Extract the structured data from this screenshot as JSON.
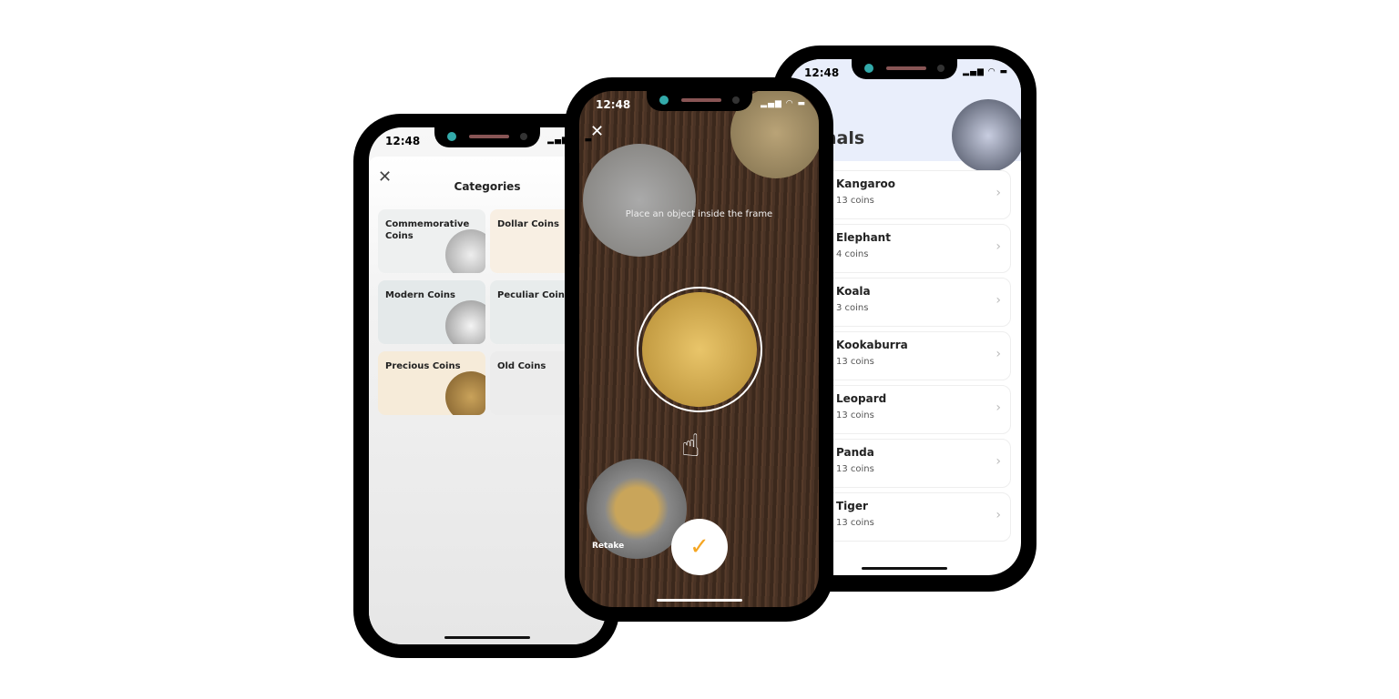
{
  "status": {
    "time": "12:48"
  },
  "categories": {
    "title": "Categories",
    "tiles": [
      {
        "label": "Commemorative Coins"
      },
      {
        "label": "Dollar Coins"
      },
      {
        "label": "Modern Coins"
      },
      {
        "label": "Peculiar Coins"
      },
      {
        "label": "Precious Coins"
      },
      {
        "label": "Old Coins"
      }
    ]
  },
  "camera": {
    "hint": "Place an object inside the frame",
    "retake": "Retake"
  },
  "animals": {
    "title_partial": "nals",
    "items": [
      {
        "name": "Kangaroo",
        "count": "13 coins"
      },
      {
        "name": "Elephant",
        "count": "4 coins"
      },
      {
        "name": "Koala",
        "count": "3 coins"
      },
      {
        "name": "Kookaburra",
        "count": "13 coins"
      },
      {
        "name": "Leopard",
        "count": "13 coins"
      },
      {
        "name": "Panda",
        "count": "13 coins"
      },
      {
        "name": "Tiger",
        "count": "13 coins"
      }
    ]
  },
  "colors": {
    "accent": "#f5a623"
  }
}
